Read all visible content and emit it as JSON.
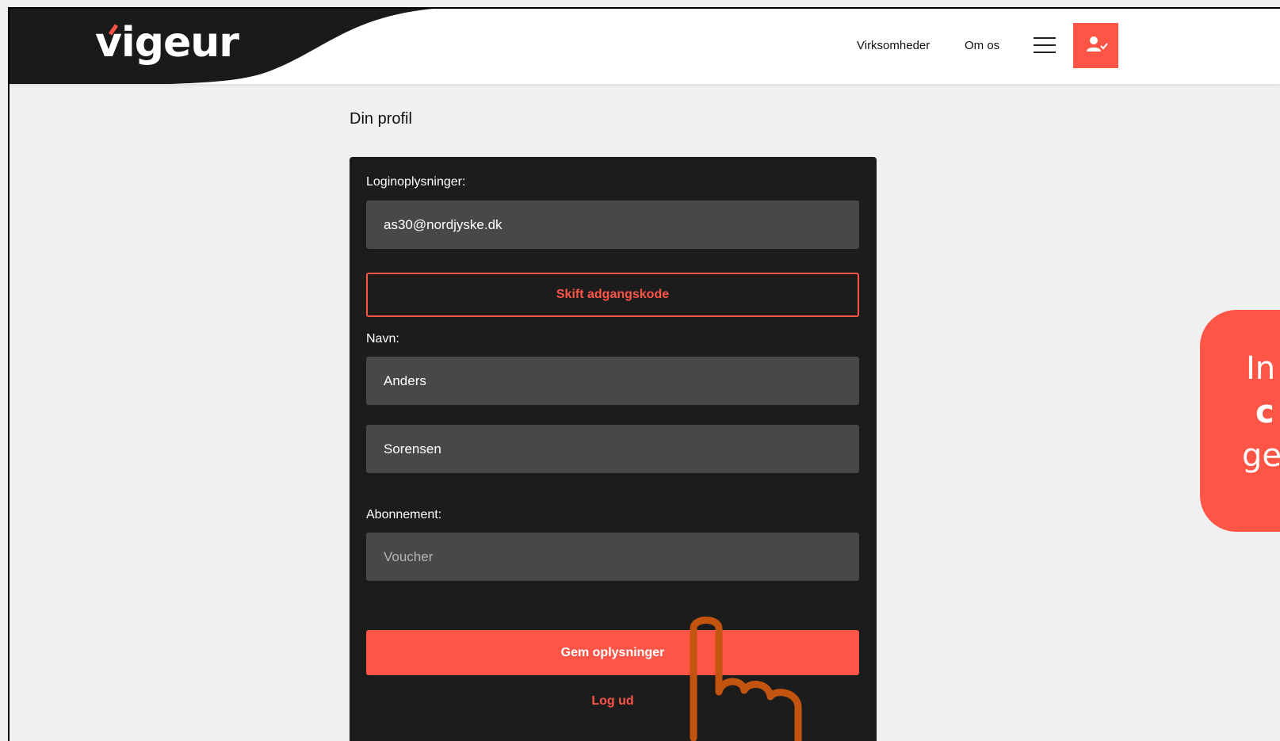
{
  "header": {
    "logo": "vigeur",
    "nav": [
      "Virksomheder",
      "Om os"
    ],
    "menu_icon": "hamburger-menu-icon",
    "user_icon": "user-check-icon"
  },
  "page": {
    "title": "Din profil"
  },
  "profile_form": {
    "login_label": "Loginoplysninger:",
    "email_value": "as30@nordjyske.dk",
    "change_password_label": "Skift adgangskode",
    "name_label": "Navn:",
    "first_name_value": "Anders",
    "last_name_value": "Sorensen",
    "subscription_label": "Abonnement:",
    "voucher_placeholder": "Voucher",
    "save_label": "Gem oplysninger",
    "logout_label": "Log ud"
  },
  "callout": {
    "line1": "In",
    "line2": "c",
    "line3": "ge"
  },
  "colors": {
    "accent": "#ff5547",
    "card_bg": "#1c1c1c",
    "field_bg": "#484848",
    "page_bg": "#f0f0f0",
    "pointer_outline": "#c25410"
  }
}
